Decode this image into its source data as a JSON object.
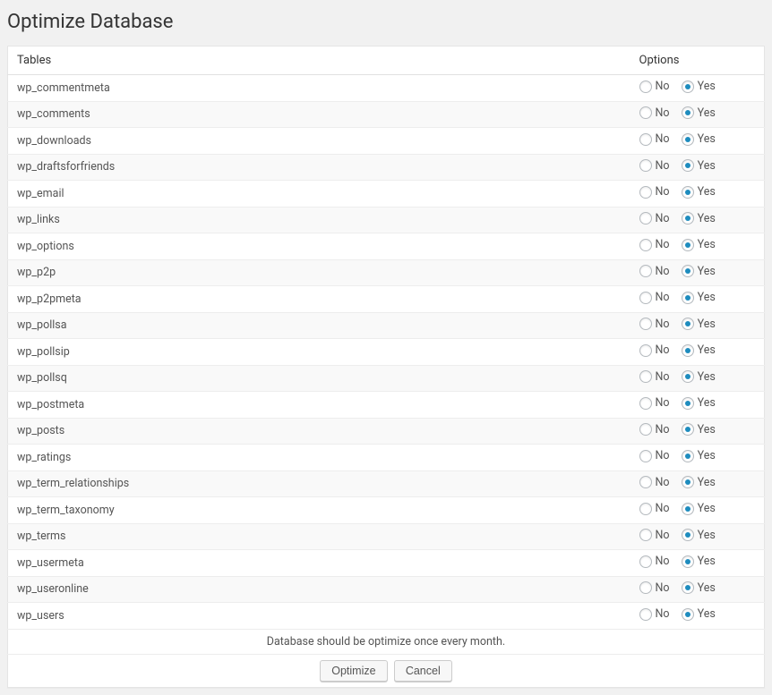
{
  "page_title": "Optimize Database",
  "columns": {
    "tables": "Tables",
    "options": "Options"
  },
  "option_labels": {
    "no": "No",
    "yes": "Yes"
  },
  "tables": [
    {
      "name": "wp_commentmeta",
      "selected": "yes"
    },
    {
      "name": "wp_comments",
      "selected": "yes"
    },
    {
      "name": "wp_downloads",
      "selected": "yes"
    },
    {
      "name": "wp_draftsforfriends",
      "selected": "yes"
    },
    {
      "name": "wp_email",
      "selected": "yes"
    },
    {
      "name": "wp_links",
      "selected": "yes"
    },
    {
      "name": "wp_options",
      "selected": "yes"
    },
    {
      "name": "wp_p2p",
      "selected": "yes"
    },
    {
      "name": "wp_p2pmeta",
      "selected": "yes"
    },
    {
      "name": "wp_pollsa",
      "selected": "yes"
    },
    {
      "name": "wp_pollsip",
      "selected": "yes"
    },
    {
      "name": "wp_pollsq",
      "selected": "yes"
    },
    {
      "name": "wp_postmeta",
      "selected": "yes"
    },
    {
      "name": "wp_posts",
      "selected": "yes"
    },
    {
      "name": "wp_ratings",
      "selected": "yes"
    },
    {
      "name": "wp_term_relationships",
      "selected": "yes"
    },
    {
      "name": "wp_term_taxonomy",
      "selected": "yes"
    },
    {
      "name": "wp_terms",
      "selected": "yes"
    },
    {
      "name": "wp_usermeta",
      "selected": "yes"
    },
    {
      "name": "wp_useronline",
      "selected": "yes"
    },
    {
      "name": "wp_users",
      "selected": "yes"
    }
  ],
  "hint": "Database should be optimize once every month.",
  "buttons": {
    "optimize": "Optimize",
    "cancel": "Cancel"
  }
}
